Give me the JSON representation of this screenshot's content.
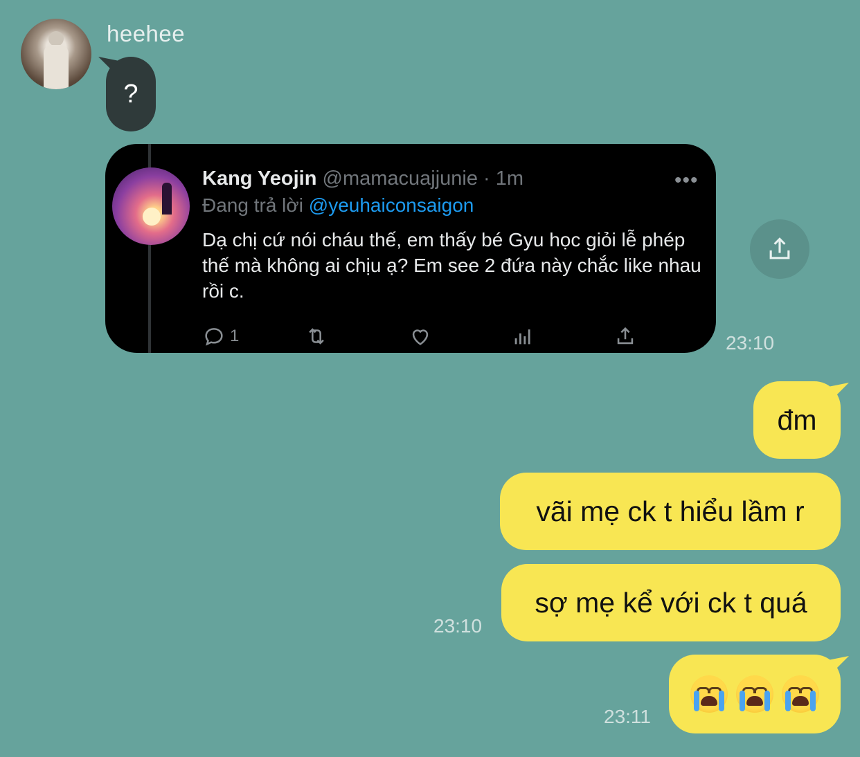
{
  "incoming": {
    "sender_name": "heehee",
    "message": "?"
  },
  "tweet": {
    "name": "Kang Yeojin",
    "handle_time": "@mamacuajjunie · 1m",
    "reply_prefix": "Đang trả lời ",
    "reply_mention": "@yeuhaiconsaigon",
    "body": "Dạ chị cứ nói cháu thế, em thấy bé Gyu học giỏi lễ phép thế mà không ai chịu ạ? Em see 2 đứa này chắc like nhau rồi c.",
    "reply_count": "1",
    "more_icon": "•••",
    "icons": [
      "reply-icon",
      "retweet-icon",
      "like-icon",
      "analytics-icon",
      "share-icon"
    ],
    "timestamp": "23:10"
  },
  "outgoing": {
    "msg1": "đm",
    "msg2": "vãi mẹ ck t hiểu lầm r",
    "msg3": "sợ mẹ kể với ck t quá",
    "msg3_time": "23:10",
    "msg4_emoji": "😭😭😭",
    "msg4_time": "23:11"
  },
  "colors": {
    "background": "#66a39c",
    "outgoing_bubble": "#f8e653",
    "incoming_bubble": "#2f3a3a",
    "tweet_bg": "#000000",
    "mention": "#1d9bf0"
  }
}
